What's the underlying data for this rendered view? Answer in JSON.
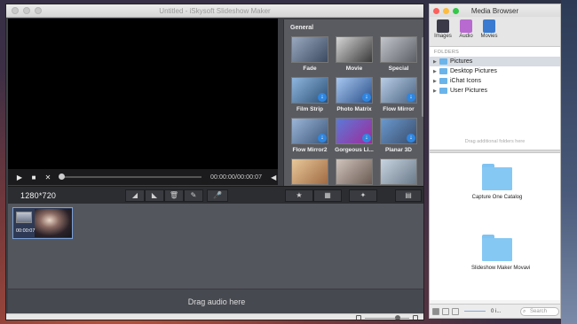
{
  "app": {
    "title": "Untitled - iSkysoft Slideshow Maker",
    "player": {
      "play_icon": "▶",
      "stop_icon": "■",
      "close_icon": "✕",
      "time": "00:00:00/00:00:07",
      "volume_icon": "◀"
    },
    "effects": {
      "group_title": "General",
      "items": [
        {
          "label": "Fade",
          "c1": "#9aa9bf",
          "c2": "#3b4a60",
          "download": false
        },
        {
          "label": "Movie",
          "c1": "#d6d6d6",
          "c2": "#3a3a3a",
          "download": false
        },
        {
          "label": "Special",
          "c1": "#c2c6cc",
          "c2": "#5c5f66",
          "download": false
        },
        {
          "label": "Film Strip",
          "c1": "#8fb6de",
          "c2": "#2c5177",
          "download": true
        },
        {
          "label": "Photo Matrix",
          "c1": "#a8c8f0",
          "c2": "#2a4f8a",
          "download": true
        },
        {
          "label": "Flow Mirror",
          "c1": "#b9cde6",
          "c2": "#4a6482",
          "download": true
        },
        {
          "label": "Flow Mirror2",
          "c1": "#9bb6d8",
          "c2": "#3b5678",
          "download": true
        },
        {
          "label": "Gorgeous Li...",
          "c1": "#5a7ad8",
          "c2": "#a02a9a",
          "download": true
        },
        {
          "label": "Planar 3D",
          "c1": "#6a9ad0",
          "c2": "#3a4c6a",
          "download": true
        },
        {
          "label": "",
          "c1": "#e8c89a",
          "c2": "#a06a42",
          "download": false
        },
        {
          "label": "",
          "c1": "#d0c4bc",
          "c2": "#6a5a52",
          "download": false
        },
        {
          "label": "",
          "c1": "#c8d4e0",
          "c2": "#6a7a8a",
          "download": false
        }
      ]
    },
    "toolbar": {
      "resolution": "1280*720",
      "tools": [
        "◢",
        "◣",
        "🗑",
        "✎",
        "🎤"
      ],
      "right_tools": [
        "★",
        "▦",
        "✦",
        "▤"
      ]
    },
    "clip": {
      "duration": "00:00:07"
    },
    "audio_hint": "Drag audio here"
  },
  "media_browser": {
    "title": "Media Browser",
    "tabs": [
      {
        "label": "Images",
        "color": "#3a3a48"
      },
      {
        "label": "Audio",
        "color": "#b86ad0"
      },
      {
        "label": "Movies",
        "color": "#3a7ad0"
      }
    ],
    "folders_header": "FOLDERS",
    "folders": [
      {
        "label": "Pictures",
        "selected": true
      },
      {
        "label": "Desktop Pictures",
        "selected": false
      },
      {
        "label": "iChat Icons",
        "selected": false
      },
      {
        "label": "User Pictures",
        "selected": false
      }
    ],
    "folders_hint": "Drag additional folders here",
    "files": [
      {
        "label": "Capture One Catalog"
      },
      {
        "label": "Slideshow Maker Movavi"
      }
    ],
    "count": "0 i...",
    "search_placeholder": "Search"
  }
}
